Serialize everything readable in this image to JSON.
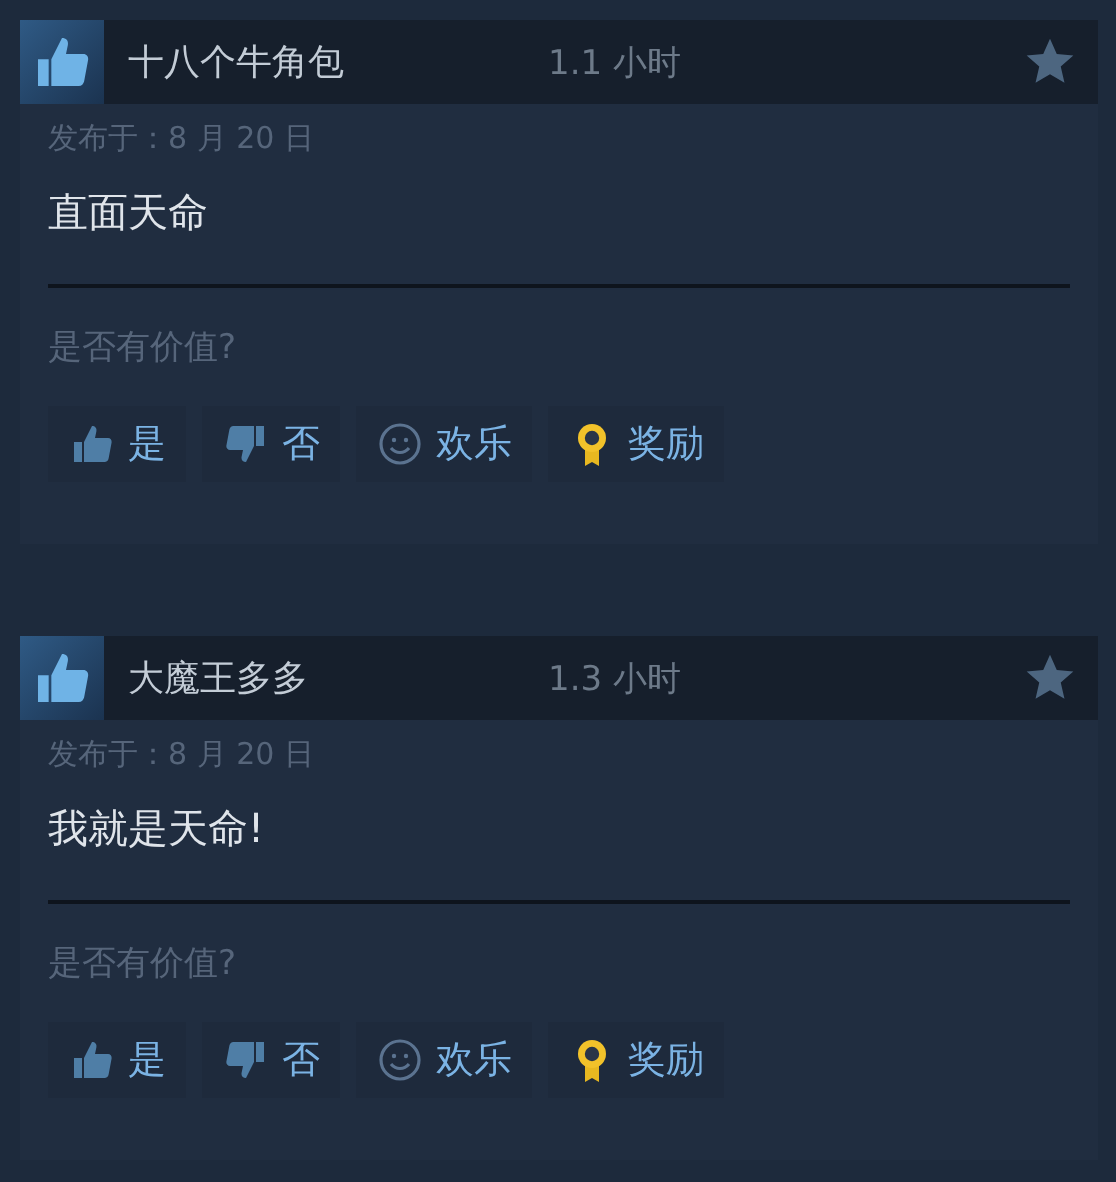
{
  "reviews": [
    {
      "recommended": true,
      "author": "十八个牛角包",
      "hours": "1.1 小时",
      "posted": "发布于：8 月 20 日",
      "text": "直面天命",
      "helpful_prompt": "是否有价值?",
      "buttons": [
        {
          "kind": "yes",
          "label": "是"
        },
        {
          "kind": "no",
          "label": "否"
        },
        {
          "kind": "funny",
          "label": "欢乐"
        },
        {
          "kind": "award",
          "label": "奖励"
        }
      ]
    },
    {
      "recommended": true,
      "author": "大魔王多多",
      "hours": "1.3 小时",
      "posted": "发布于：8 月 20 日",
      "text": "我就是天命!",
      "helpful_prompt": "是否有价值?",
      "buttons": [
        {
          "kind": "yes",
          "label": "是"
        },
        {
          "kind": "no",
          "label": "否"
        },
        {
          "kind": "funny",
          "label": "欢乐"
        },
        {
          "kind": "award",
          "label": "奖励"
        }
      ]
    }
  ]
}
